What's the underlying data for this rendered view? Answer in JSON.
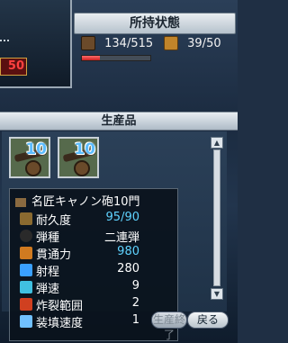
{
  "status": {
    "title": "所持状態",
    "hp_value": "134/515",
    "hp_fraction": 0.26,
    "cargo_value": "39/50"
  },
  "left_panel": {
    "red_value": "50"
  },
  "production": {
    "title": "生産品",
    "items": [
      {
        "count": "10"
      },
      {
        "count": "10"
      }
    ]
  },
  "tooltip": {
    "name": "名匠キャノン砲10門",
    "stats": [
      {
        "label": "耐久度",
        "value": "95/90"
      },
      {
        "label": "弾種",
        "value": "二連弾"
      },
      {
        "label": "貫通力",
        "value": "980"
      },
      {
        "label": "射程",
        "value": "280"
      },
      {
        "label": "弾速",
        "value": "9"
      },
      {
        "label": "炸裂範囲",
        "value": "2"
      },
      {
        "label": "装填速度",
        "value": "1"
      }
    ]
  },
  "buttons": {
    "end_production": "生産終了",
    "back": "戻る"
  }
}
